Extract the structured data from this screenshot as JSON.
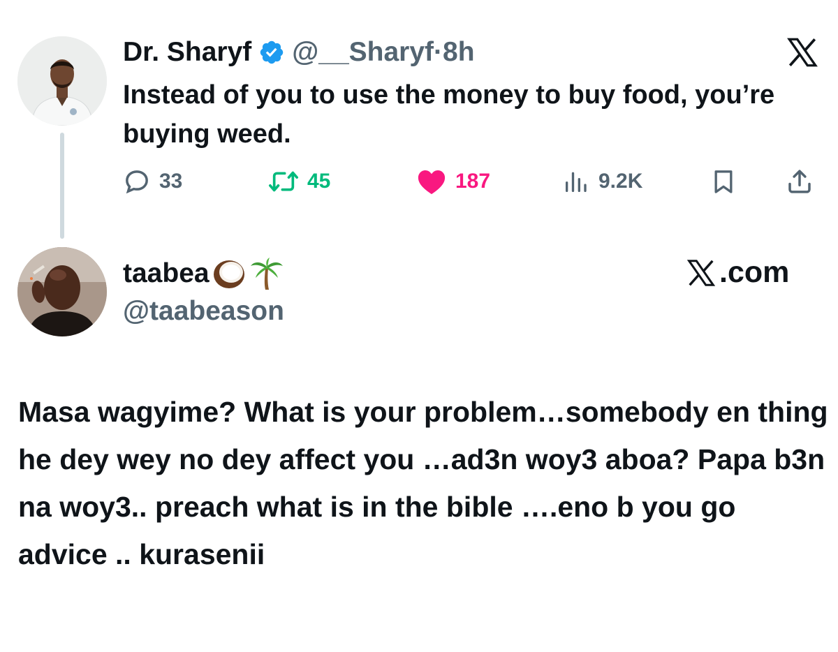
{
  "tweet": {
    "author": {
      "name": "Dr. Sharyf",
      "handle": "@__Sharyf",
      "separator": "·",
      "time": "8h",
      "verified": true
    },
    "text": "Instead of you to use the money to buy food, you’re buying weed.",
    "stats": {
      "replies": "33",
      "reposts": "45",
      "likes": "187",
      "views": "9.2K"
    }
  },
  "reply": {
    "author": {
      "name": "taabea",
      "emojis": [
        "coconut",
        "palm-tree"
      ],
      "handle": "@taabeason"
    },
    "text": "Masa wagyime? What is your problem…somebody en thing he dey  wey no dey affect you …ad3n woy3 aboa? Papa b3n na woy3.. preach what is in the bible ….eno b you go advice .. kurasenii",
    "source_label": ".com"
  },
  "icons": {
    "verified": "verified-badge-icon",
    "platform": "x-logo-icon",
    "reply": "speech-bubble-icon",
    "repost": "repost-arrows-icon",
    "like": "heart-icon",
    "views": "bar-chart-icon",
    "bookmark": "bookmark-icon",
    "share": "share-upload-icon"
  },
  "colors": {
    "text": "#0f1419",
    "secondary": "#536471",
    "verified": "#1d9bf0",
    "repost": "#00ba7c",
    "like": "#f91880",
    "thread_line": "#cfd9de"
  }
}
